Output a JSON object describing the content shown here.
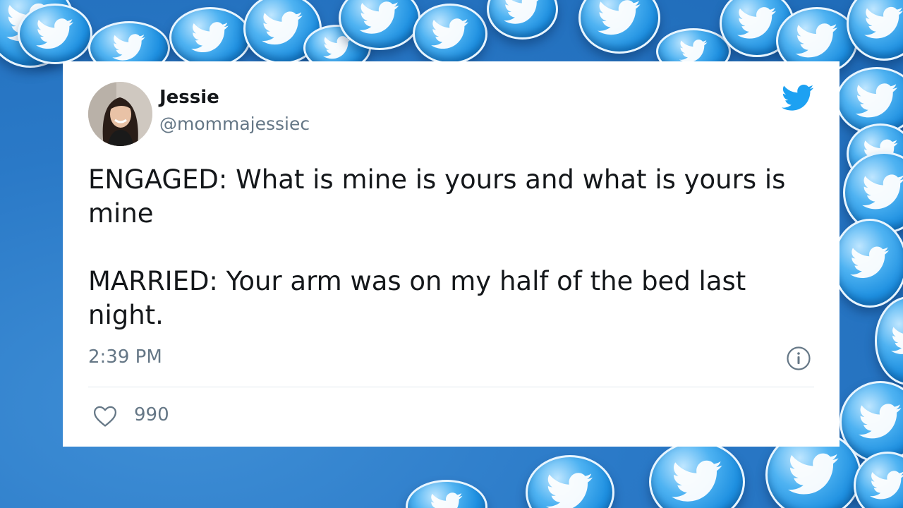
{
  "tweet": {
    "author": {
      "display_name": "Jessie",
      "handle": "@mommajessiec"
    },
    "text": "ENGAGED: What is mine is yours and what is yours is mine\n\nMARRIED: Your arm was on my half of the bed last night.",
    "timestamp": "2:39 PM",
    "like_count": "990"
  },
  "icons": {
    "brand": "twitter-bird-icon",
    "info": "info-icon",
    "like": "heart-icon"
  },
  "colors": {
    "brand_blue": "#1da1f2",
    "muted_text": "#657786",
    "main_text": "#14171a"
  }
}
